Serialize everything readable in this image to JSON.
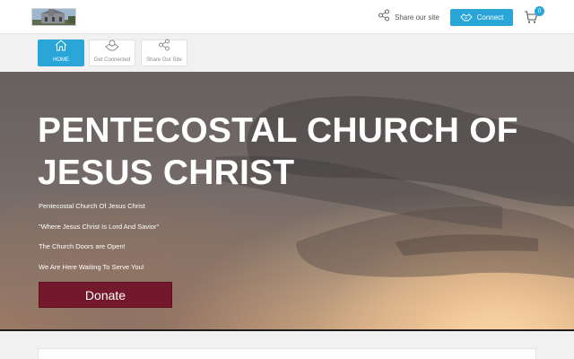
{
  "header": {
    "logo_alt": "church-logo",
    "share_label": "Share our site",
    "connect_label": "Connect",
    "cart_count": "0"
  },
  "nav": {
    "items": [
      {
        "label": "HOME",
        "icon": "home-icon",
        "active": true
      },
      {
        "label": "Get Connected",
        "icon": "handshake-icon",
        "active": false
      },
      {
        "label": "Share Our Site",
        "icon": "share-icon",
        "active": false
      }
    ]
  },
  "hero": {
    "title": "PENTECOSTAL CHURCH OF JESUS CHRIST",
    "lines": [
      "Pentecostal Church Of Jesus Christ",
      "\"Where Jesus Christ Is Lord And Savior\"",
      "The Church Doors are Open!",
      "We Are Here Waiting To Serve You!"
    ],
    "donate_label": "Donate"
  },
  "colors": {
    "accent": "#2aa5d8",
    "donate": "#74192b",
    "background": "#f1f1f1"
  }
}
